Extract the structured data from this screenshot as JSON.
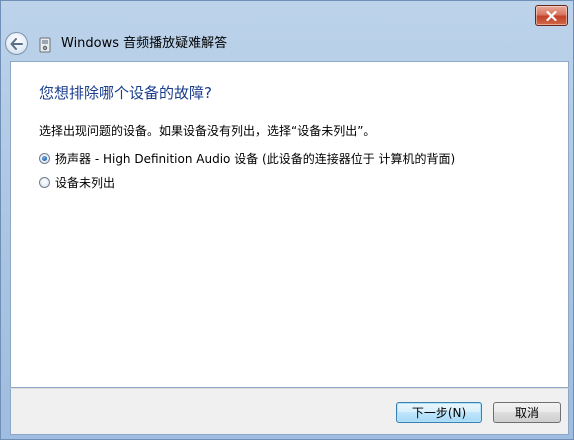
{
  "window": {
    "title": "Windows 音频播放疑难解答",
    "icons": {
      "close": "close-icon",
      "back": "back-arrow-icon",
      "app": "troubleshooter-icon"
    },
    "colors": {
      "heading": "#1a3e8c",
      "close_button": "#c3412a",
      "frame": "#a9c4e2"
    }
  },
  "main": {
    "heading": "您想排除哪个设备的故障?",
    "instruction": "选择出现问题的设备。如果设备没有列出，选择“设备未列出”。",
    "options": [
      {
        "label": "扬声器 - High Definition Audio 设备 (此设备的连接器位于 计算机的背面)",
        "selected": true
      },
      {
        "label": "设备未列出",
        "selected": false
      }
    ]
  },
  "footer": {
    "next_label": "下一步(N)",
    "cancel_label": "取消"
  }
}
